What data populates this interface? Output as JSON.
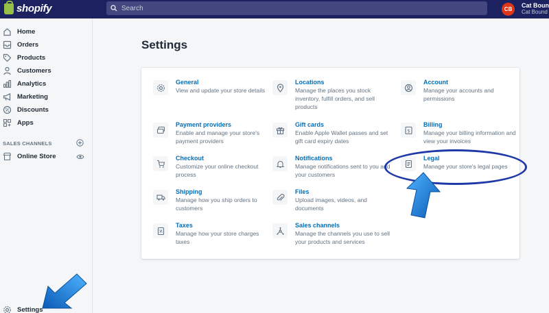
{
  "app": {
    "brand": "shopify"
  },
  "search": {
    "placeholder": "Search"
  },
  "user": {
    "initials": "CB",
    "name": "Cat Bound",
    "shop": "Cat Bound"
  },
  "sidebar": {
    "items": [
      {
        "label": "Home",
        "icon": "home-icon"
      },
      {
        "label": "Orders",
        "icon": "orders-icon"
      },
      {
        "label": "Products",
        "icon": "tag-icon"
      },
      {
        "label": "Customers",
        "icon": "customer-icon"
      },
      {
        "label": "Analytics",
        "icon": "analytics-icon"
      },
      {
        "label": "Marketing",
        "icon": "megaphone-icon"
      },
      {
        "label": "Discounts",
        "icon": "discount-icon"
      },
      {
        "label": "Apps",
        "icon": "apps-icon"
      }
    ],
    "channels_heading": "SALES CHANNELS",
    "online_store": "Online Store",
    "settings": "Settings"
  },
  "main": {
    "title": "Settings",
    "settings": [
      {
        "title": "General",
        "desc": "View and update your store details",
        "icon": "gear-icon"
      },
      {
        "title": "Locations",
        "desc": "Manage the places you stock inventory, fulfill orders, and sell products",
        "icon": "location-pin-icon"
      },
      {
        "title": "Account",
        "desc": "Manage your accounts and permissions",
        "icon": "account-icon"
      },
      {
        "title": "Payment providers",
        "desc": "Enable and manage your store's payment providers",
        "icon": "payment-icon"
      },
      {
        "title": "Gift cards",
        "desc": "Enable Apple Wallet passes and set gift card expiry dates",
        "icon": "gift-icon"
      },
      {
        "title": "Billing",
        "desc": "Manage your billing information and view your invoices",
        "icon": "billing-icon"
      },
      {
        "title": "Checkout",
        "desc": "Customize your online checkout process",
        "icon": "cart-icon"
      },
      {
        "title": "Notifications",
        "desc": "Manage notifications sent to you and your customers",
        "icon": "bell-icon"
      },
      {
        "title": "Legal",
        "desc": "Manage your store's legal pages",
        "icon": "legal-icon"
      },
      {
        "title": "Shipping",
        "desc": "Manage how you ship orders to customers",
        "icon": "truck-icon"
      },
      {
        "title": "Files",
        "desc": "Upload images, videos, and documents",
        "icon": "paperclip-icon"
      },
      {
        "title": "Taxes",
        "desc": "Manage how your store charges taxes",
        "icon": "tax-icon"
      },
      {
        "title": "Sales channels",
        "desc": "Manage the channels you use to sell your products and services",
        "icon": "channels-icon"
      }
    ]
  },
  "colors": {
    "topbar": "#1c2260",
    "link": "#006fbb",
    "annotation": "#1f3aa8",
    "arrow": "#1e90e0"
  }
}
